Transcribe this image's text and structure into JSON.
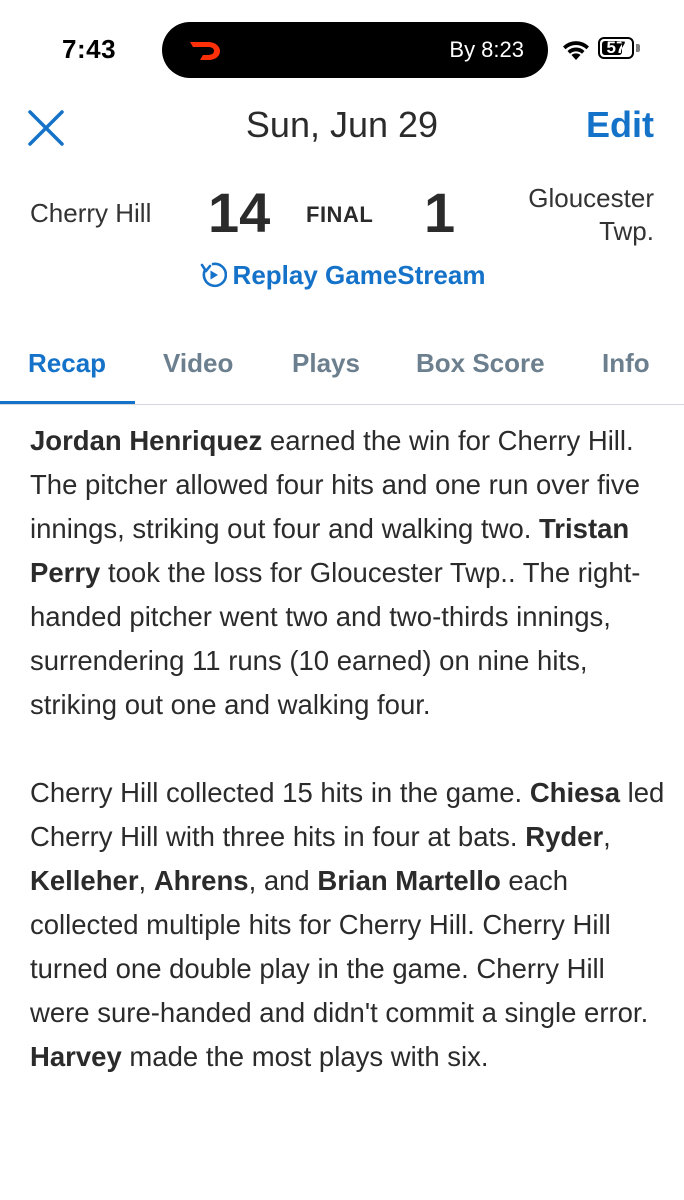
{
  "status_bar": {
    "time": "7:43",
    "live_activity_text": "By 8:23",
    "live_activity_icon": "doordash-logo-icon",
    "battery": "57",
    "brand_color": "#ff3008"
  },
  "nav": {
    "title": "Sun, Jun 29",
    "edit_label": "Edit",
    "close_icon": "close-icon",
    "accent": "#1572c9"
  },
  "game": {
    "home_team": "Cherry Hill",
    "home_score": "14",
    "status": "FINAL",
    "away_score": "1",
    "away_team_line1": "Gloucester",
    "away_team_line2": "Twp.",
    "replay_label": "Replay GameStream"
  },
  "tabs": [
    {
      "label": "Recap",
      "active": true
    },
    {
      "label": "Video",
      "active": false
    },
    {
      "label": "Plays",
      "active": false
    },
    {
      "label": "Box Score",
      "active": false
    },
    {
      "label": "Info",
      "active": false
    }
  ],
  "recap": {
    "p1": {
      "s1_name": "Jordan Henriquez",
      "s1_text": " earned the win for Cherry Hill. The pitcher allowed four hits and one run over five innings, striking out four and walking two. ",
      "s2_name": "Tristan Perry",
      "s2_text": " took the loss for Gloucester Twp.. The right-handed pitcher went two and two-thirds innings, surrendering 11 runs (10 earned) on nine hits, striking out one and walking four."
    },
    "p2": {
      "t1": "Cherry Hill collected 15 hits in the game. ",
      "n1": "Chiesa",
      "t2": " led Cherry Hill with three hits in four at bats. ",
      "n2": "Ryder",
      "t3": ", ",
      "n3": "Kelleher",
      "t4": ", ",
      "n4": "Ahrens",
      "t5": ", and ",
      "n5": "Brian Martello",
      "t6": " each collected multiple hits for Cherry Hill. Cherry Hill turned one double play in the game. Cherry Hill were sure-handed and didn't commit a single error. ",
      "n6": "Harvey",
      "t7": " made the most plays with six."
    }
  }
}
